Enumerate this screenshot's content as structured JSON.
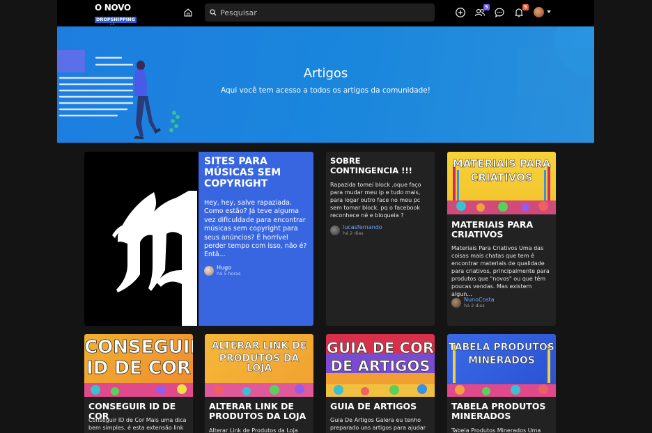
{
  "header": {
    "logo_line1": "O NOVO",
    "logo_line2": "DROPSHIPPING",
    "logo_line3": "2.0",
    "search_placeholder": "Pesquisar",
    "badges": {
      "friends": "5",
      "notifications": "5"
    }
  },
  "hero": {
    "title": "Artigos",
    "subtitle": "Aqui você tem acesso a todos os artigos da comunidade!"
  },
  "colors": {
    "hero": "#1a86dc",
    "featured_card": "#3866e0",
    "link": "#6fa3ff",
    "friends_badge": "#7b5cf0",
    "notif_badge": "#f06040"
  },
  "articles": [
    {
      "title": "SITES PARA MÚSICAS SEM COPYRIGHT",
      "excerpt": "Hey, hey, salve rapaziada. Como estão? Já teve alguma vez dificuldade para encontrar músicas sem copyright para seus anúncios? É horrível perder tempo com isso, não é? Entã...",
      "author": "Hugo",
      "time": "há 5 horas",
      "thumb_icon": "gothic-letter-m-icon"
    },
    {
      "title": "SOBRE CONTINGENCIA !!!",
      "excerpt": "Rapazida tomei block ,oque faço para mudar meu ip e tudo mais, para logar outro face no meu pc sem tomar block.   pq o facebook reconhece né e bloqueia ?",
      "author": "lucasfernando",
      "time": "há 2 dias"
    },
    {
      "title": "MATERIAIS PARA CRIATIVOS",
      "excerpt": "Materiais Para Criativos Uma das coisas mais chatas que tem é encontrar materiais de qualidade para criativos, principalmente para produtos que \"novos\" ou que têm poucas vendas. Mas existem algun...",
      "author": "NunoCosta",
      "time": "há 2 dias",
      "thumb_line1": "MATERIAIS PARA",
      "thumb_line2": "CRIATIVOS"
    },
    {
      "title": "CONSEGUIR ID DE COR",
      "excerpt": "Conseguir ID de Cor Mais uma dica bem simples, é esta extensão link",
      "thumb_line1": "CONSEGUIR",
      "thumb_line2": "ID DE COR"
    },
    {
      "title": "ALTERAR LINK DE PRODUTOS DA LOJA",
      "excerpt": "Alterar Link de Produtos da Loja Uma",
      "thumb_line1": "ALTERAR LINK DE",
      "thumb_line2": "PRODUTOS DA LOJA"
    },
    {
      "title": "GUIA DE ARTIGOS",
      "excerpt": "Guia De Artigos Galera eu tenho preparado uns artigos para ajudar",
      "thumb_line1": "GUIA DE COR",
      "thumb_line2": "DE ARTIGOS"
    },
    {
      "title": "TABELA PRODUTOS MINERADOS",
      "excerpt": "Tabela Produtos Minerados Uma",
      "thumb_line1": "TABELA PRODUTOS",
      "thumb_line2": "MINERADOS"
    }
  ]
}
